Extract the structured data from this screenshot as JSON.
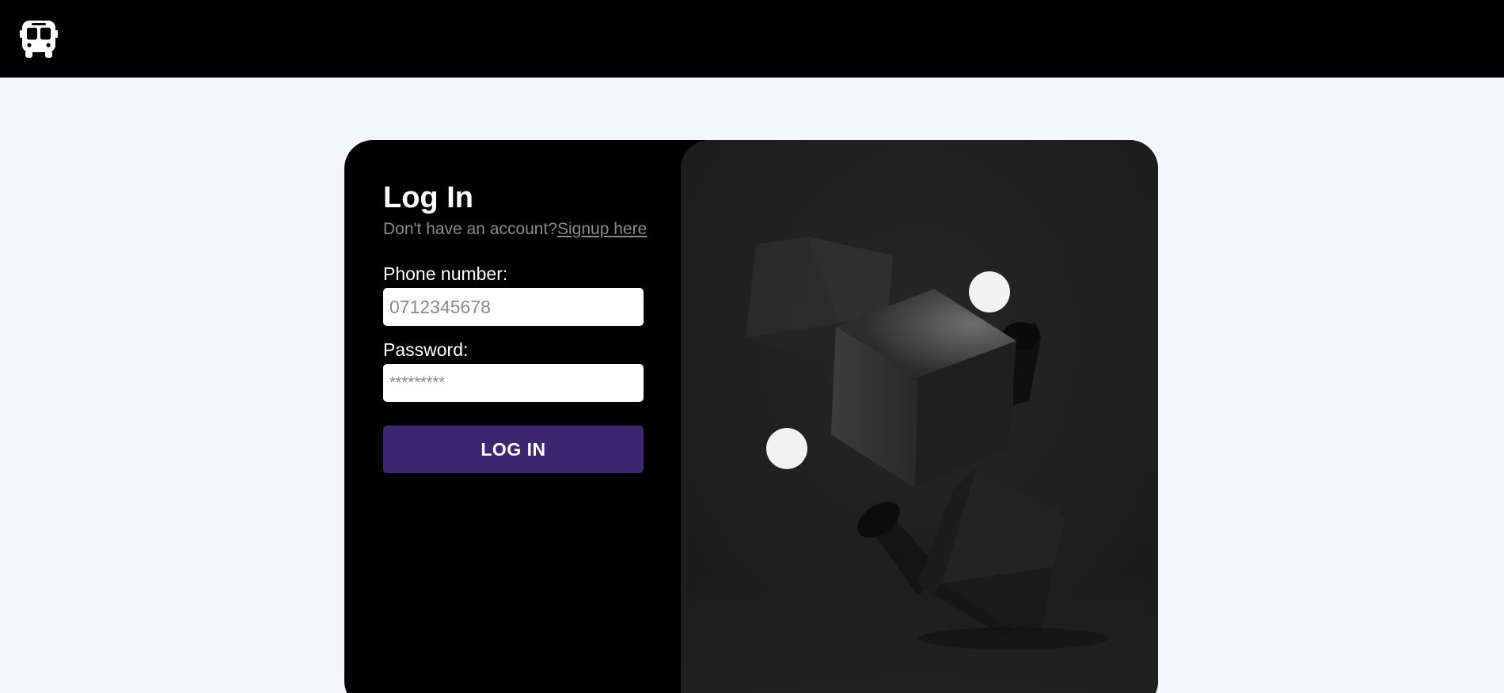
{
  "header": {
    "logo_icon": "bus-icon"
  },
  "login": {
    "title": "Log In",
    "no_account_text": "Don't have an account?",
    "signup_link": "Signup here",
    "phone_label": "Phone number:",
    "phone_placeholder": "0712345678",
    "phone_value": "",
    "password_label": "Password:",
    "password_placeholder": "*********",
    "password_value": "",
    "submit_label": "LOG IN"
  },
  "colors": {
    "header_bg": "#000000",
    "page_bg": "#f4f6fa",
    "card_bg": "#000000",
    "button_bg": "#3d2670",
    "muted_text": "#8a8a8a"
  },
  "illustration": {
    "icon": "floating-cubes-illustration"
  }
}
